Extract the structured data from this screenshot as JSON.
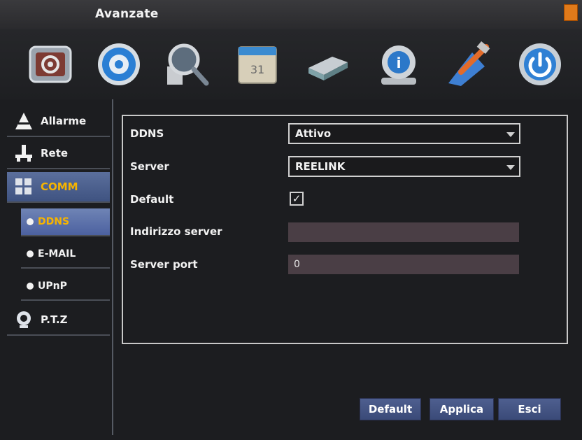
{
  "window": {
    "title": "Avanzate"
  },
  "toolbar": {
    "icons": [
      "system-settings-icon",
      "record-icon",
      "search-icon",
      "schedule-icon",
      "hdd-icon",
      "info-icon",
      "tools-icon",
      "power-icon"
    ]
  },
  "sidebar": {
    "items": [
      {
        "label": "Allarme",
        "icon": "alarm-icon"
      },
      {
        "label": "Rete",
        "icon": "network-icon"
      },
      {
        "label": "COMM",
        "icon": "comm-icon",
        "active": true
      },
      {
        "label": "DDNS",
        "sub": true,
        "active": true
      },
      {
        "label": "E-MAIL",
        "sub": true
      },
      {
        "label": "UPnP",
        "sub": true
      },
      {
        "label": "P.T.Z",
        "icon": "ptz-icon"
      }
    ]
  },
  "form": {
    "ddns_label": "DDNS",
    "ddns_value": "Attivo",
    "server_label": "Server",
    "server_value": "REELINK",
    "default_label": "Default",
    "default_checked": "✓",
    "address_label": "Indirizzo server",
    "address_value": "",
    "port_label": "Server port",
    "port_value": "0"
  },
  "buttons": {
    "default": "Default",
    "apply": "Applica",
    "exit": "Esci"
  },
  "colors": {
    "accent": "#f6b400",
    "active_bg": "#4c61a0",
    "window_close": "#e07a1a"
  }
}
